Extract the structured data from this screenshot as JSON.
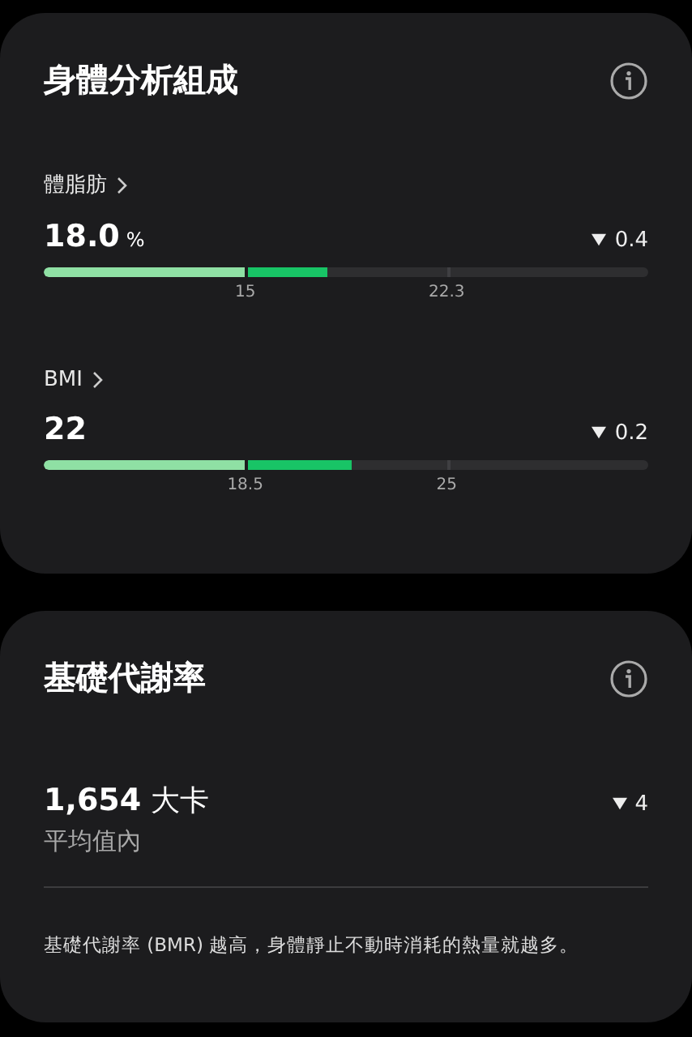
{
  "body_composition": {
    "title": "身體分析組成",
    "metrics": [
      {
        "label": "體脂肪",
        "value": "18.0",
        "unit": "%",
        "decreased": true,
        "change": "0.4",
        "level": 0.47,
        "ticks": [
          "15",
          "22.3"
        ]
      },
      {
        "label": "BMI",
        "value": "22",
        "decreased": true,
        "change": "0.2",
        "level": 0.51,
        "ticks": [
          "18.5",
          "25"
        ]
      }
    ]
  },
  "bmr": {
    "title": "基礎代謝率",
    "value": "1,654",
    "unit": "大卡",
    "decreased": true,
    "change": "4",
    "status": "平均值內",
    "description": "基礎代謝率 (BMR) 越高，身體靜止不動時消耗的熱量就越多。"
  }
}
